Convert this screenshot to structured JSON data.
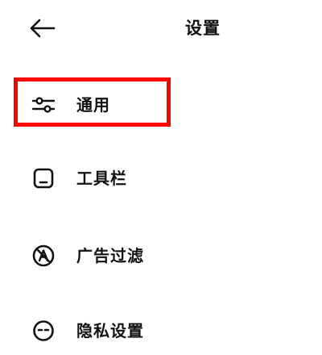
{
  "header": {
    "back_icon": "arrow-left-icon",
    "title": "设置"
  },
  "menu": {
    "items": [
      {
        "icon": "sliders-icon",
        "label": "通用",
        "highlighted": true
      },
      {
        "icon": "toolbar-icon",
        "label": "工具栏"
      },
      {
        "icon": "ad-block-icon",
        "label": "广告过滤"
      },
      {
        "icon": "privacy-mask-icon",
        "label": "隐私设置"
      }
    ]
  },
  "colors": {
    "text": "#111111",
    "background": "#ffffff",
    "highlight": "#ff0000"
  }
}
